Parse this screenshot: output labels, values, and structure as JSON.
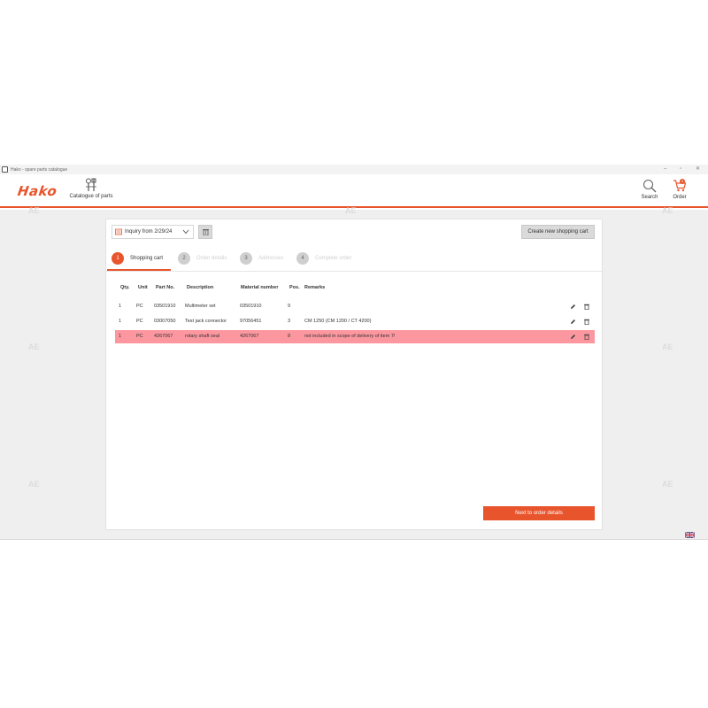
{
  "window": {
    "title": "Hako - spare parts catalogue",
    "controls": {
      "minimize": "–",
      "maximize": "▫",
      "close": "✕"
    }
  },
  "header": {
    "logo": "Hako",
    "catalogue_label": "Catalogue of parts",
    "search_label": "Search",
    "order_label": "Order",
    "order_badge": "3"
  },
  "watermark": "AE",
  "toolbar": {
    "cart_name": "Inquiry from 2/29/24",
    "new_cart_label": "Create new shopping cart"
  },
  "steps": [
    {
      "num": "1",
      "label": "Shopping cart"
    },
    {
      "num": "2",
      "label": "Order details"
    },
    {
      "num": "3",
      "label": "Addresses"
    },
    {
      "num": "4",
      "label": "Complete order"
    }
  ],
  "table": {
    "columns": [
      "Qty.",
      "Unit",
      "Part No.",
      "Description",
      "Material number",
      "Pos.",
      "Remarks"
    ],
    "rows": [
      {
        "qty": "1",
        "unit": "PC",
        "part_no": "03501910",
        "description": "Multimeter set",
        "material": "03501910",
        "pos": "9",
        "remarks": ""
      },
      {
        "qty": "1",
        "unit": "PC",
        "part_no": "03007050",
        "description": "Test jack connector",
        "material": "97056451",
        "pos": "3",
        "remarks": "CM 1250 (CM 1200 / CT 4200)"
      },
      {
        "qty": "1",
        "unit": "PC",
        "part_no": "4267067",
        "description": "rotary shaft seal",
        "material": "4267067",
        "pos": "8",
        "remarks": "not included in scope of delivery of item 7!"
      }
    ]
  },
  "next_button": "Next to order details",
  "colors": {
    "accent": "#e8542c",
    "highlight_row": "#fc97a0"
  }
}
